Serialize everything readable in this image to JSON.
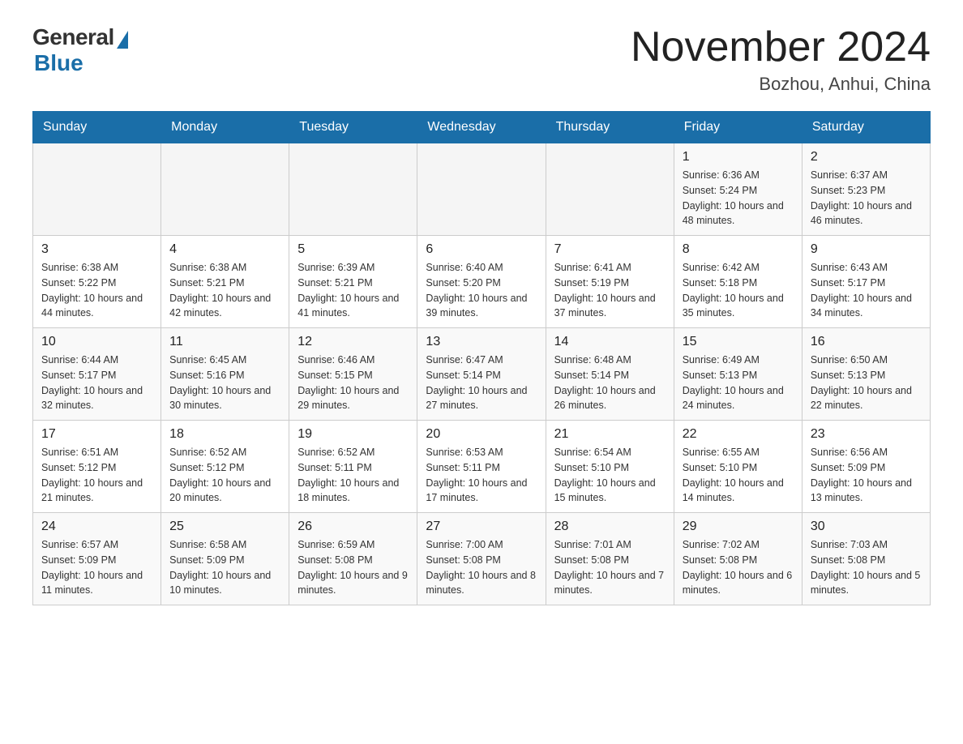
{
  "logo": {
    "general_text": "General",
    "blue_text": "Blue"
  },
  "header": {
    "title": "November 2024",
    "location": "Bozhou, Anhui, China"
  },
  "days_of_week": [
    "Sunday",
    "Monday",
    "Tuesday",
    "Wednesday",
    "Thursday",
    "Friday",
    "Saturday"
  ],
  "weeks": [
    {
      "days": [
        {
          "number": "",
          "info": ""
        },
        {
          "number": "",
          "info": ""
        },
        {
          "number": "",
          "info": ""
        },
        {
          "number": "",
          "info": ""
        },
        {
          "number": "",
          "info": ""
        },
        {
          "number": "1",
          "info": "Sunrise: 6:36 AM\nSunset: 5:24 PM\nDaylight: 10 hours and 48 minutes."
        },
        {
          "number": "2",
          "info": "Sunrise: 6:37 AM\nSunset: 5:23 PM\nDaylight: 10 hours and 46 minutes."
        }
      ]
    },
    {
      "days": [
        {
          "number": "3",
          "info": "Sunrise: 6:38 AM\nSunset: 5:22 PM\nDaylight: 10 hours and 44 minutes."
        },
        {
          "number": "4",
          "info": "Sunrise: 6:38 AM\nSunset: 5:21 PM\nDaylight: 10 hours and 42 minutes."
        },
        {
          "number": "5",
          "info": "Sunrise: 6:39 AM\nSunset: 5:21 PM\nDaylight: 10 hours and 41 minutes."
        },
        {
          "number": "6",
          "info": "Sunrise: 6:40 AM\nSunset: 5:20 PM\nDaylight: 10 hours and 39 minutes."
        },
        {
          "number": "7",
          "info": "Sunrise: 6:41 AM\nSunset: 5:19 PM\nDaylight: 10 hours and 37 minutes."
        },
        {
          "number": "8",
          "info": "Sunrise: 6:42 AM\nSunset: 5:18 PM\nDaylight: 10 hours and 35 minutes."
        },
        {
          "number": "9",
          "info": "Sunrise: 6:43 AM\nSunset: 5:17 PM\nDaylight: 10 hours and 34 minutes."
        }
      ]
    },
    {
      "days": [
        {
          "number": "10",
          "info": "Sunrise: 6:44 AM\nSunset: 5:17 PM\nDaylight: 10 hours and 32 minutes."
        },
        {
          "number": "11",
          "info": "Sunrise: 6:45 AM\nSunset: 5:16 PM\nDaylight: 10 hours and 30 minutes."
        },
        {
          "number": "12",
          "info": "Sunrise: 6:46 AM\nSunset: 5:15 PM\nDaylight: 10 hours and 29 minutes."
        },
        {
          "number": "13",
          "info": "Sunrise: 6:47 AM\nSunset: 5:14 PM\nDaylight: 10 hours and 27 minutes."
        },
        {
          "number": "14",
          "info": "Sunrise: 6:48 AM\nSunset: 5:14 PM\nDaylight: 10 hours and 26 minutes."
        },
        {
          "number": "15",
          "info": "Sunrise: 6:49 AM\nSunset: 5:13 PM\nDaylight: 10 hours and 24 minutes."
        },
        {
          "number": "16",
          "info": "Sunrise: 6:50 AM\nSunset: 5:13 PM\nDaylight: 10 hours and 22 minutes."
        }
      ]
    },
    {
      "days": [
        {
          "number": "17",
          "info": "Sunrise: 6:51 AM\nSunset: 5:12 PM\nDaylight: 10 hours and 21 minutes."
        },
        {
          "number": "18",
          "info": "Sunrise: 6:52 AM\nSunset: 5:12 PM\nDaylight: 10 hours and 20 minutes."
        },
        {
          "number": "19",
          "info": "Sunrise: 6:52 AM\nSunset: 5:11 PM\nDaylight: 10 hours and 18 minutes."
        },
        {
          "number": "20",
          "info": "Sunrise: 6:53 AM\nSunset: 5:11 PM\nDaylight: 10 hours and 17 minutes."
        },
        {
          "number": "21",
          "info": "Sunrise: 6:54 AM\nSunset: 5:10 PM\nDaylight: 10 hours and 15 minutes."
        },
        {
          "number": "22",
          "info": "Sunrise: 6:55 AM\nSunset: 5:10 PM\nDaylight: 10 hours and 14 minutes."
        },
        {
          "number": "23",
          "info": "Sunrise: 6:56 AM\nSunset: 5:09 PM\nDaylight: 10 hours and 13 minutes."
        }
      ]
    },
    {
      "days": [
        {
          "number": "24",
          "info": "Sunrise: 6:57 AM\nSunset: 5:09 PM\nDaylight: 10 hours and 11 minutes."
        },
        {
          "number": "25",
          "info": "Sunrise: 6:58 AM\nSunset: 5:09 PM\nDaylight: 10 hours and 10 minutes."
        },
        {
          "number": "26",
          "info": "Sunrise: 6:59 AM\nSunset: 5:08 PM\nDaylight: 10 hours and 9 minutes."
        },
        {
          "number": "27",
          "info": "Sunrise: 7:00 AM\nSunset: 5:08 PM\nDaylight: 10 hours and 8 minutes."
        },
        {
          "number": "28",
          "info": "Sunrise: 7:01 AM\nSunset: 5:08 PM\nDaylight: 10 hours and 7 minutes."
        },
        {
          "number": "29",
          "info": "Sunrise: 7:02 AM\nSunset: 5:08 PM\nDaylight: 10 hours and 6 minutes."
        },
        {
          "number": "30",
          "info": "Sunrise: 7:03 AM\nSunset: 5:08 PM\nDaylight: 10 hours and 5 minutes."
        }
      ]
    }
  ]
}
